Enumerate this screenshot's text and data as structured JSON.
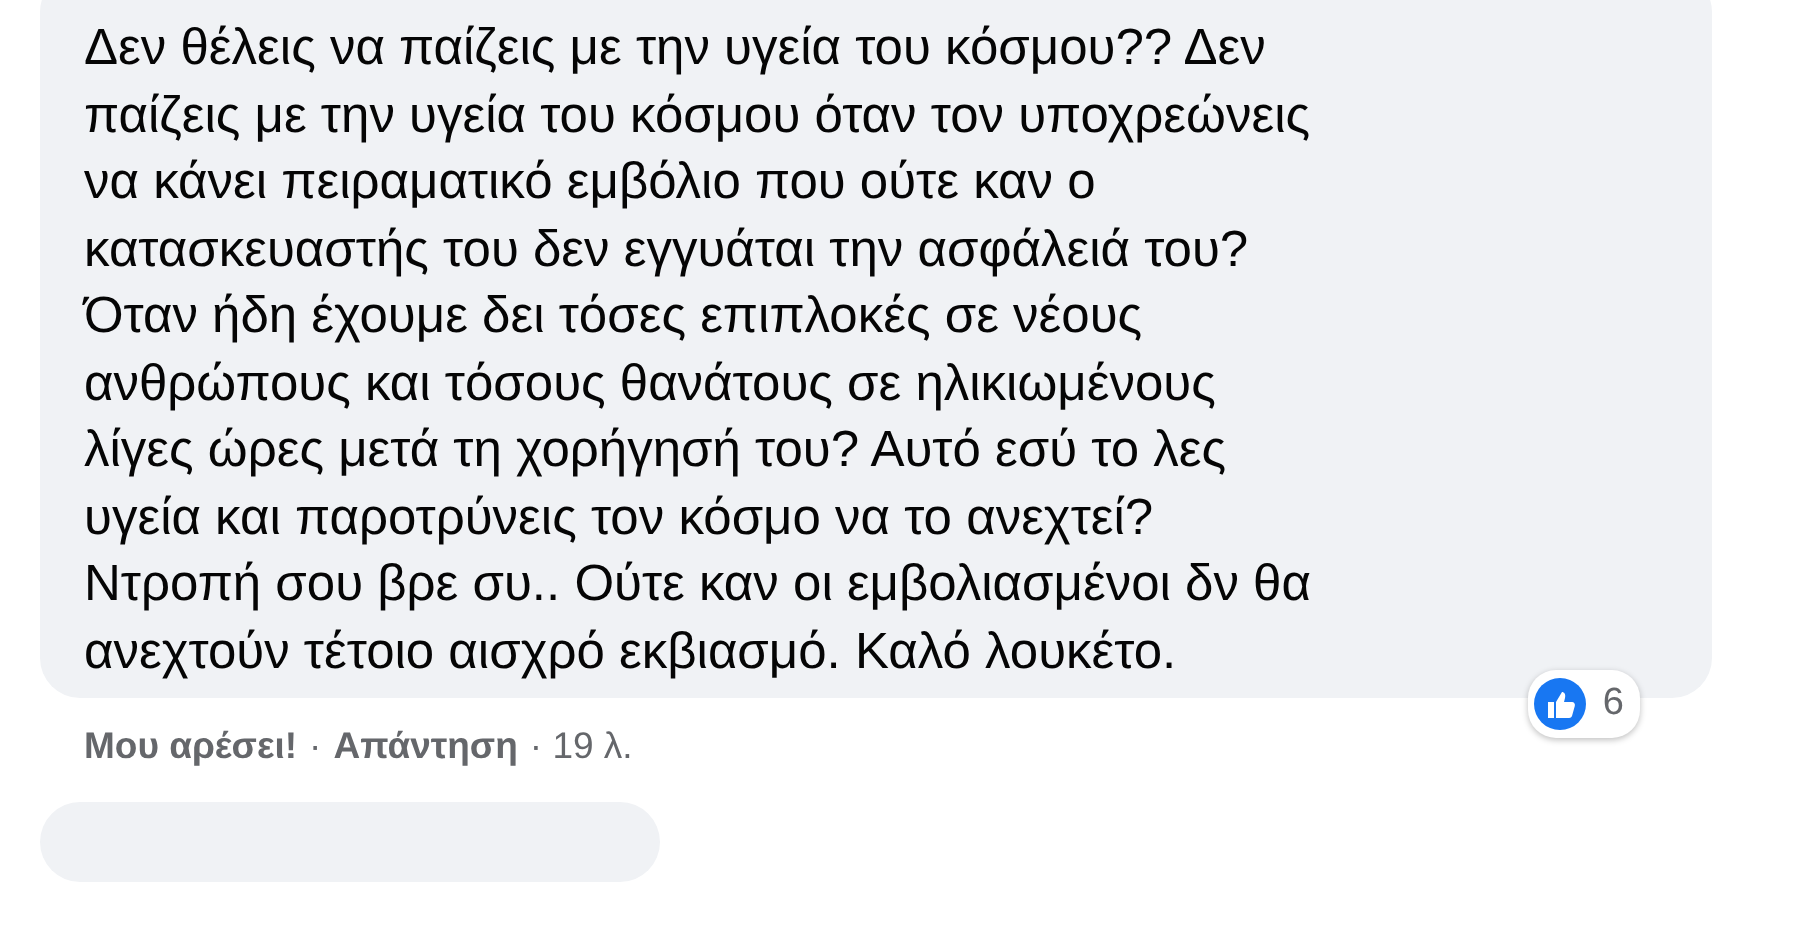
{
  "comment": {
    "lines": [
      "Δεν θέλεις να παίζεις με την υγεία του κόσμου?? Δεν",
      "παίζεις με την υγεία του κόσμου όταν τον υποχρεώνεις",
      "να κάνει πειραματικό εμβόλιο που ούτε καν ο",
      "κατασκευαστής του δεν εγγυάται την ασφάλειά του?",
      "Όταν ήδη έχουμε δει τόσες επιπλοκές σε νέους",
      "ανθρώπους και τόσους θανάτους σε ηλικιωμένους",
      "λίγες ώρες μετά τη χορήγησή του? Αυτό εσύ το λες",
      "υγεία και παροτρύνεις τον κόσμο να το ανεχτεί?",
      "Ντροπή σου βρε συ.. Ούτε καν οι εμβολιασμένοι δν θα",
      "ανεχτούν τέτοιο αισχρό εκβιασμό. Καλό λουκέτο."
    ],
    "reactions": {
      "count": "6"
    },
    "actions": [
      {
        "label": "Μου αρέσει!",
        "kind": "link"
      },
      {
        "label": "·",
        "kind": "sep"
      },
      {
        "label": "Απάντηση",
        "kind": "link"
      },
      {
        "label": "· 19 λ.",
        "kind": "time"
      }
    ]
  }
}
